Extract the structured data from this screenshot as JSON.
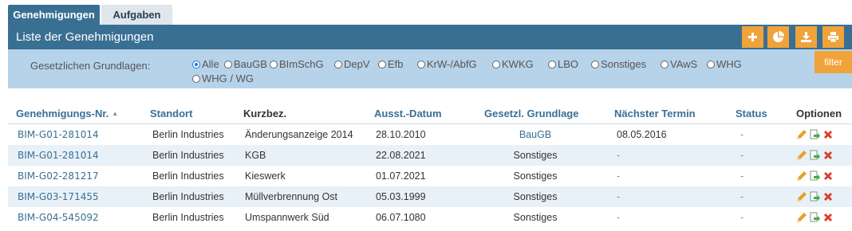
{
  "tabs": [
    {
      "label": "Genehmigungen",
      "active": true
    },
    {
      "label": "Aufgaben",
      "active": false
    }
  ],
  "header": {
    "title": "Liste der Genehmigungen",
    "buttons": [
      {
        "name": "add-button",
        "icon": "plus-icon"
      },
      {
        "name": "chart-button",
        "icon": "pie-chart-icon"
      },
      {
        "name": "download-button",
        "icon": "download-icon"
      },
      {
        "name": "print-button",
        "icon": "print-icon"
      }
    ]
  },
  "filter": {
    "label": "Gesetzlichen Grundlagen:",
    "options": [
      "Alle",
      "BauGB",
      "BImSchG",
      "DepV",
      "Efb",
      "KrW-/AbfG",
      "KWKG",
      "LBO",
      "Sonstiges",
      "VAwS",
      "WHG",
      "WHG / WG"
    ],
    "selected": "Alle",
    "button_label": "filter"
  },
  "table": {
    "columns": [
      "Genehmigungs-Nr.",
      "Standort",
      "Kurzbez.",
      "Ausst.-Datum",
      "Gesetzl. Grundlage",
      "Nächster Termin",
      "Status",
      "Optionen"
    ],
    "rows": [
      {
        "nr": "BIM-G01-281014",
        "standort": "Berlin Industries",
        "kurzbez": "Änderungsanzeige 2014",
        "datum": "28.10.2010",
        "grundlage": "BauGB",
        "termin": "08.05.2016",
        "status": "-"
      },
      {
        "nr": "BIM-G01-281014",
        "standort": "Berlin Industries",
        "kurzbez": "KGB",
        "datum": "22.08.2021",
        "grundlage": "Sonstiges",
        "termin": "-",
        "status": "-"
      },
      {
        "nr": "BIM-G02-281217",
        "standort": "Berlin Industries",
        "kurzbez": "Kieswerk",
        "datum": "01.07.2021",
        "grundlage": "Sonstiges",
        "termin": "-",
        "status": "-"
      },
      {
        "nr": "BIM-G03-171455",
        "standort": "Berlin Industries",
        "kurzbez": "Müllverbrennung Ost",
        "datum": "05.03.1999",
        "grundlage": "Sonstiges",
        "termin": "-",
        "status": "-"
      },
      {
        "nr": "BIM-G04-545092",
        "standort": "Berlin Industries",
        "kurzbez": "Umspannwerk Süd",
        "datum": "06.07.1080",
        "grundlage": "Sonstiges",
        "termin": "-",
        "status": "-"
      }
    ]
  },
  "colors": {
    "primary": "#3a6f94",
    "accent": "#f0a33a",
    "filter_bg": "#b7d3ea",
    "row_alt": "#e8f1f8",
    "edit_icon": "#e8a02a",
    "delete_icon": "#e03a2a",
    "open_icon": "#4aa84a"
  }
}
